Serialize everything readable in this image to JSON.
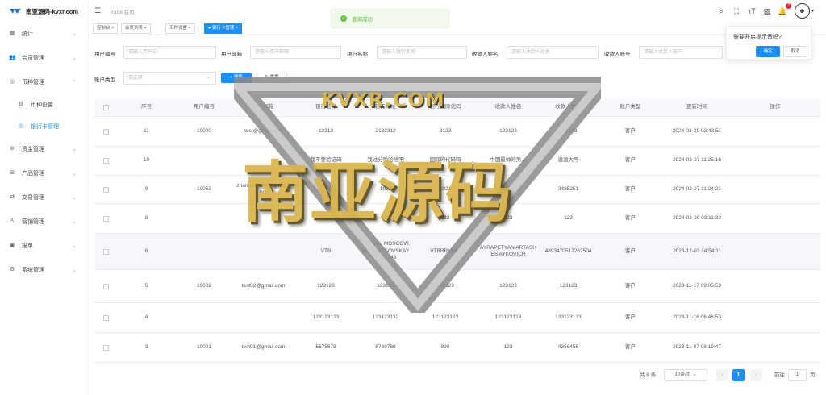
{
  "app": {
    "logo_text": "南亚源码-kvxr.com"
  },
  "sidebar": {
    "items": [
      {
        "label": "统计",
        "icon": "chart-icon",
        "arrow": "⌄"
      },
      {
        "label": "会员管理",
        "icon": "users-icon",
        "arrow": "⌄"
      },
      {
        "label": "币种管理",
        "icon": "coin-icon",
        "arrow": "⌃"
      },
      {
        "label": "币种设置",
        "icon": "gear-icon"
      },
      {
        "label": "银行卡管理",
        "icon": "card-icon"
      },
      {
        "label": "资金管理",
        "icon": "wallet-icon",
        "arrow": "⌄"
      },
      {
        "label": "产品管理",
        "icon": "product-icon",
        "arrow": "⌄"
      },
      {
        "label": "交易管理",
        "icon": "trade-icon",
        "arrow": "⌄"
      },
      {
        "label": "营销管理",
        "icon": "marketing-icon",
        "arrow": "⌄"
      },
      {
        "label": "报单",
        "icon": "report-icon",
        "arrow": "⌄"
      },
      {
        "label": "系统管理",
        "icon": "system-icon",
        "arrow": "⌄"
      }
    ]
  },
  "header": {
    "breadcrumb": "route.首页",
    "notification_count": "2"
  },
  "tabs": [
    {
      "label": "控制台 ×"
    },
    {
      "label": "会员列表 ×"
    },
    {
      "label": "币种设置 ×"
    },
    {
      "label": "● 银行卡管理 ×"
    }
  ],
  "toast": {
    "text": "查询成功"
  },
  "popover": {
    "title": "需要开启提示音吗?",
    "ok": "确定",
    "cancel": "取消"
  },
  "filters": {
    "user_id": {
      "label": "用户编号",
      "placeholder": "请输入用户ID"
    },
    "email": {
      "label": "用户邮箱",
      "placeholder": "请输入用户邮箱"
    },
    "bank": {
      "label": "银行名称",
      "placeholder": "请输入银行名称"
    },
    "payee": {
      "label": "收款人姓名",
      "placeholder": "请输入收款人姓名"
    },
    "account": {
      "label": "收款人账号",
      "placeholder": "请输入收款人账户"
    },
    "type": {
      "label": "账户类型",
      "placeholder": "请选择"
    },
    "search_btn": "搜索",
    "reset_btn": "重置"
  },
  "table": {
    "headers": [
      "序号",
      "用户编号",
      "用户邮箱",
      "银行名称",
      "银行地址",
      "银行国际代码",
      "收款人姓名",
      "收款人账号",
      "账户类型",
      "更新时间",
      "操作"
    ],
    "rows": [
      [
        "11",
        "10000",
        "test@gmail.com",
        "12313",
        "2132312",
        "3123",
        "123123",
        "123123",
        "客户",
        "2024-03-29 03:43:51"
      ],
      [
        "10",
        "",
        "",
        "我不要验证码",
        "我过分啦哈哈吧",
        "国际的代码吗",
        "中国最帅的男人",
        "滋滋大号",
        "客户",
        "2024-02-27 11:25:16"
      ],
      [
        "9",
        "10053",
        "zhangsan888@gmail.com",
        "セブン銀行",
        "1021",
        "1021",
        "レスタイン",
        "3485251",
        "客户",
        "2024-02-27 11:24:21"
      ],
      [
        "8",
        "",
        "",
        "123",
        "123",
        "123",
        "123",
        "123",
        "客户",
        "2024-02-20 03:11:33"
      ],
      [
        "6",
        "",
        "",
        "VTB",
        "RUSSIA, MOSCOW, VORONTSOVSKAYA UL., 43",
        "VTBRRUMM",
        "AYRAPETYAN ARTASHES AYKOVICH",
        "4893470517262504",
        "客户",
        "2023-12-02 14:54:11"
      ],
      [
        "5",
        "10002",
        "test02@gmail.com",
        "123123",
        "123123",
        "123123",
        "123123",
        "123123",
        "客户",
        "2023-11-17 09:05:59"
      ],
      [
        "4",
        "",
        "",
        "123123123",
        "123123132",
        "123123123",
        "123123123",
        "123123123",
        "客户",
        "2023-11-16 06:46:53"
      ],
      [
        "3",
        "10001",
        "test01@gmail.com",
        "5675678",
        "6789789",
        "890",
        "123",
        "4356456",
        "客户",
        "2023-11-07 08:19:47"
      ]
    ]
  },
  "pagination": {
    "total": "共 8 条",
    "page_size": "10条/页",
    "current": "1",
    "goto_label": "前往",
    "goto_value": "1",
    "goto_suffix": "页"
  },
  "watermark": {
    "top": "KVXR.COM",
    "main": "南亚源码"
  }
}
